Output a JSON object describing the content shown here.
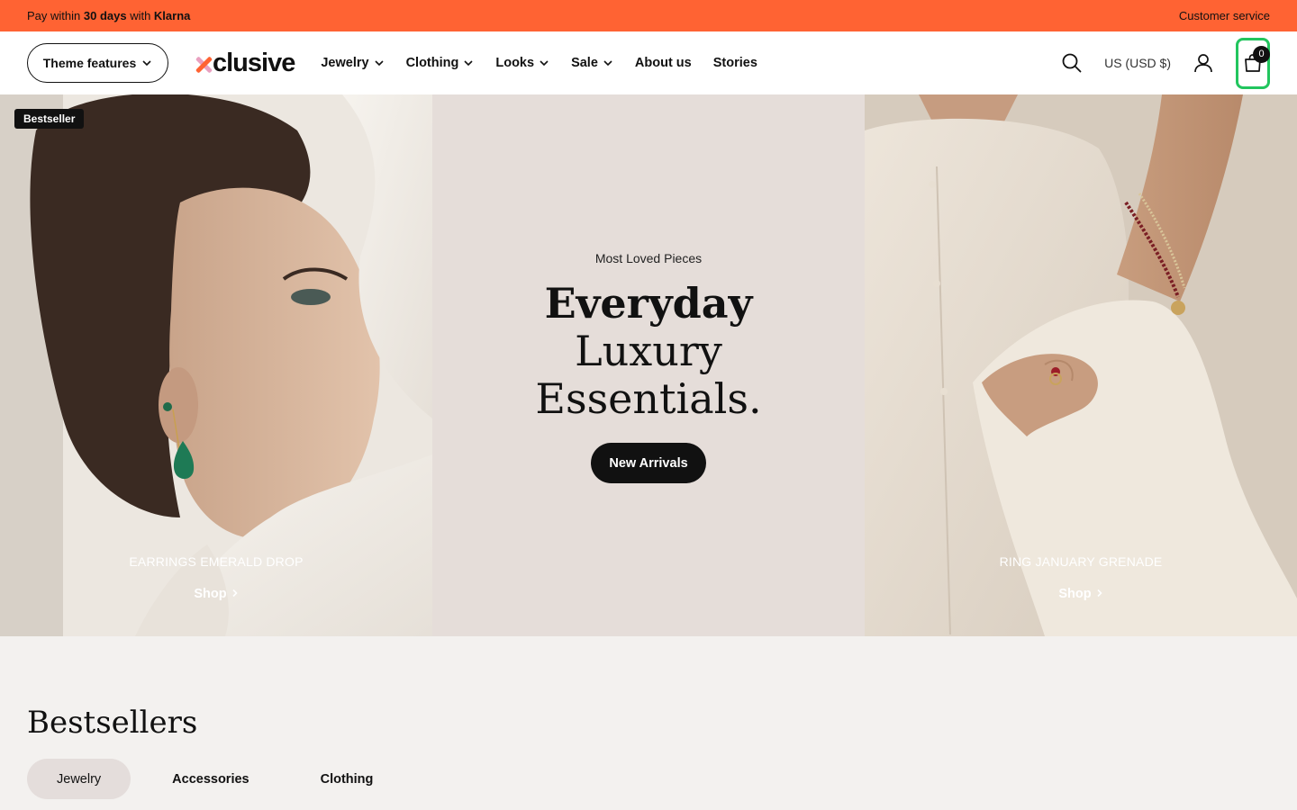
{
  "announcement": {
    "left_prefix": "Pay within ",
    "left_bold1": "30 days",
    "left_mid": " with ",
    "left_bold2": "Klarna",
    "right": "Customer service",
    "bg_color": "#ff6333"
  },
  "header": {
    "theme_button": "Theme features",
    "logo": "clusive",
    "nav": [
      {
        "label": "Jewelry",
        "has_dropdown": true
      },
      {
        "label": "Clothing",
        "has_dropdown": true
      },
      {
        "label": "Looks",
        "has_dropdown": true
      },
      {
        "label": "Sale",
        "has_dropdown": true
      },
      {
        "label": "About us",
        "has_dropdown": false
      },
      {
        "label": "Stories",
        "has_dropdown": false
      }
    ],
    "currency": "US (USD $)",
    "cart_count": "0",
    "icons": [
      "search-icon",
      "user-icon",
      "bag-icon"
    ]
  },
  "hero": {
    "left": {
      "badge": "Bestseller",
      "product": "EARRINGS EMERALD DROP",
      "link": "Shop"
    },
    "center": {
      "eyebrow": "Most Loved Pieces",
      "headline_bold": "Everyday",
      "headline_line2": "Luxury",
      "headline_line3": "Essentials.",
      "cta": "New Arrivals"
    },
    "right": {
      "product": "RING JANUARY GRENADE",
      "link": "Shop"
    }
  },
  "bestsellers": {
    "title": "Bestsellers",
    "tabs": [
      {
        "label": "Jewelry",
        "active": true
      },
      {
        "label": "Accessories",
        "active": false
      },
      {
        "label": "Clothing",
        "active": false
      }
    ]
  }
}
